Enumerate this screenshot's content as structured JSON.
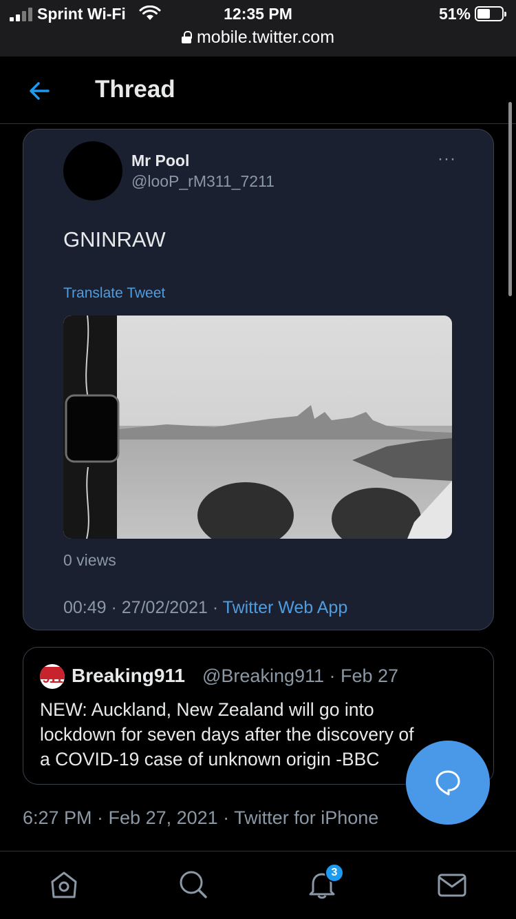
{
  "status_bar": {
    "carrier": "Sprint Wi-Fi",
    "time": "12:35 PM",
    "battery": "51%",
    "url": "mobile.twitter.com"
  },
  "header": {
    "title": "Thread"
  },
  "tweet": {
    "author_name": "Mr Pool",
    "author_handle": "@looP_rM311_7211",
    "text": "GNINRAW",
    "translate_label": "Translate Tweet",
    "views": "0 views",
    "time": "00:49",
    "date": "27/02/2021",
    "source": "Twitter Web App",
    "separator": " · "
  },
  "quoted_tweet": {
    "author_name": "Breaking911",
    "author_handle": "@Breaking911 · Feb 27",
    "avatar_text": "911",
    "text": "NEW: Auckland, New Zealand will go into\nlockdown for seven days after the discovery of\na COVID-19 case of unknown origin -BBC"
  },
  "post_meta": "6:27 PM · Feb 27, 2021 · Twitter for iPhone",
  "nav": {
    "notifications_badge": "3",
    "items": [
      "home-icon",
      "search-icon",
      "bell-icon",
      "mail-icon"
    ]
  },
  "colors": {
    "accent": "#1d9bf0",
    "card_bg": "#1b2030",
    "muted": "#8b98a5"
  }
}
